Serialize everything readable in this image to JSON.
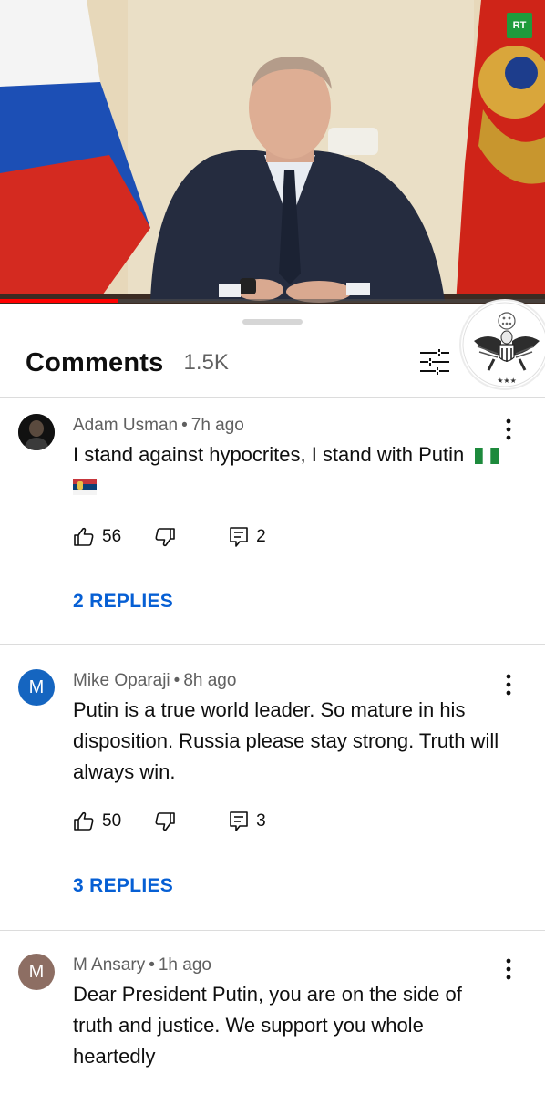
{
  "video": {
    "channel_badge": "RT",
    "progress_fraction": 0.215
  },
  "comments_panel": {
    "title": "Comments",
    "count": "1.5K",
    "filter_icon": "filter-sort-icon",
    "corner_image": "eagle-seal-icon"
  },
  "comments": [
    {
      "author": "Adam Usman",
      "time": "7h ago",
      "text": "I stand against hypocrites, I stand with Putin",
      "flags": [
        "nigeria-flag-icon",
        "serbia-flag-icon"
      ],
      "likes": "56",
      "reply_count": "2",
      "replies_label": "2 REPLIES",
      "avatar_color": "#1b1b1b"
    },
    {
      "author": "Mike Oparaji",
      "time": "8h ago",
      "text": "Putin is a true world leader. So mature in his disposition. Russia please stay strong. Truth will always win.",
      "likes": "50",
      "reply_count": "3",
      "replies_label": "3 REPLIES",
      "avatar_letter": "M",
      "avatar_color": "#1565c0"
    },
    {
      "author": "M Ansary",
      "time": "1h ago",
      "text": "Dear President Putin, you are on the side of truth and justice. We support you whole heartedly",
      "avatar_letter": "M",
      "avatar_color": "#8d6e63"
    }
  ],
  "colors": {
    "link_blue": "#065fd4",
    "progress_red": "#ff0000",
    "meta_gray": "#606060"
  }
}
